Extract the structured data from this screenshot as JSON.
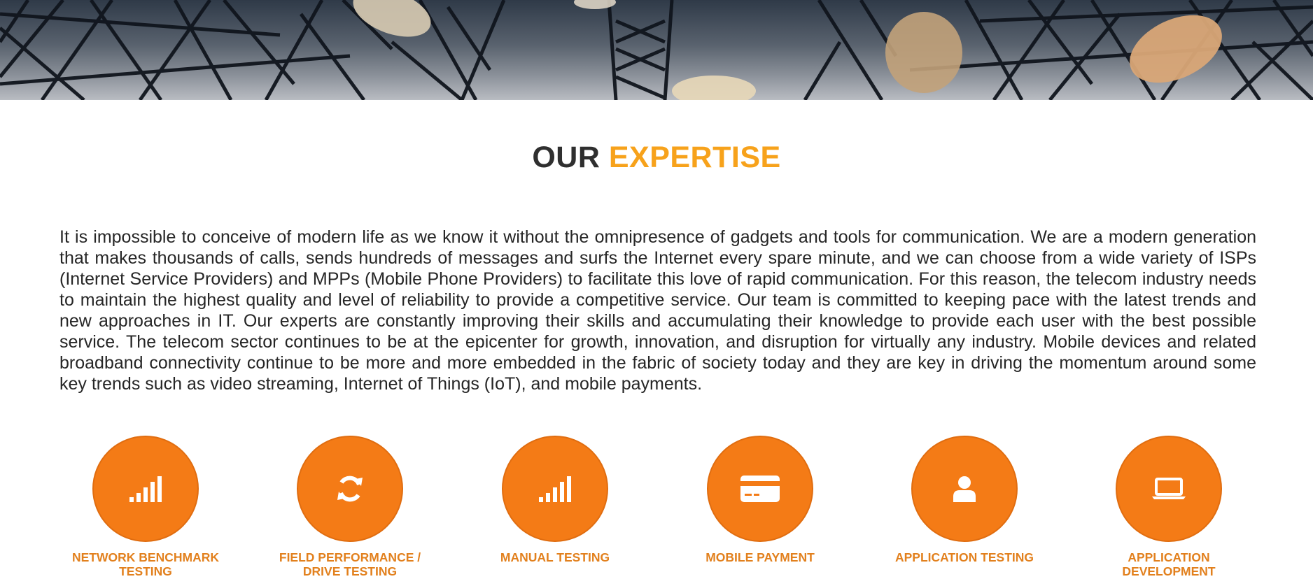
{
  "heading": {
    "part1": "OUR",
    "part2": "EXPERTISE"
  },
  "intro_text": "It is impossible to conceive of modern life as we know it without the omnipresence of gadgets and tools for communication. We are a modern generation that makes thousands of calls, sends hundreds of messages and surfs the Internet every spare minute, and we can choose from a wide variety of ISPs (Internet Service Providers) and MPPs (Mobile Phone Providers) to facilitate this love of rapid communication. For this reason, the telecom industry needs to maintain the highest quality and level of reliability to provide a competitive service. Our team is committed to keeping pace with the latest trends and new approaches in IT. Our experts are constantly improving their skills and accumulating their knowledge to provide each user with the best possible service. The telecom sector continues to be at the epicenter for growth, innovation, and disruption for virtually any industry. Mobile devices and related broadband connectivity continue to be more and more embedded in the fabric of society today and they are key in driving the momentum around some key trends such as video streaming, Internet of Things (IoT), and mobile payments.",
  "colors": {
    "accent_orange": "#f47b16",
    "heading_accent": "#f7a21b",
    "label_orange": "#e2801d",
    "text_dark": "#2b2b2b"
  },
  "services": [
    {
      "label": "NETWORK BENCHMARK TESTING",
      "icon": "signal-bars-icon"
    },
    {
      "label": "FIELD PERFORMANCE / DRIVE TESTING",
      "icon": "refresh-icon"
    },
    {
      "label": "MANUAL TESTING",
      "icon": "signal-bars-icon"
    },
    {
      "label": "MOBILE PAYMENT",
      "icon": "credit-card-icon"
    },
    {
      "label": "APPLICATION TESTING",
      "icon": "user-icon"
    },
    {
      "label": "APPLICATION DEVELOPMENT",
      "icon": "laptop-icon"
    }
  ]
}
